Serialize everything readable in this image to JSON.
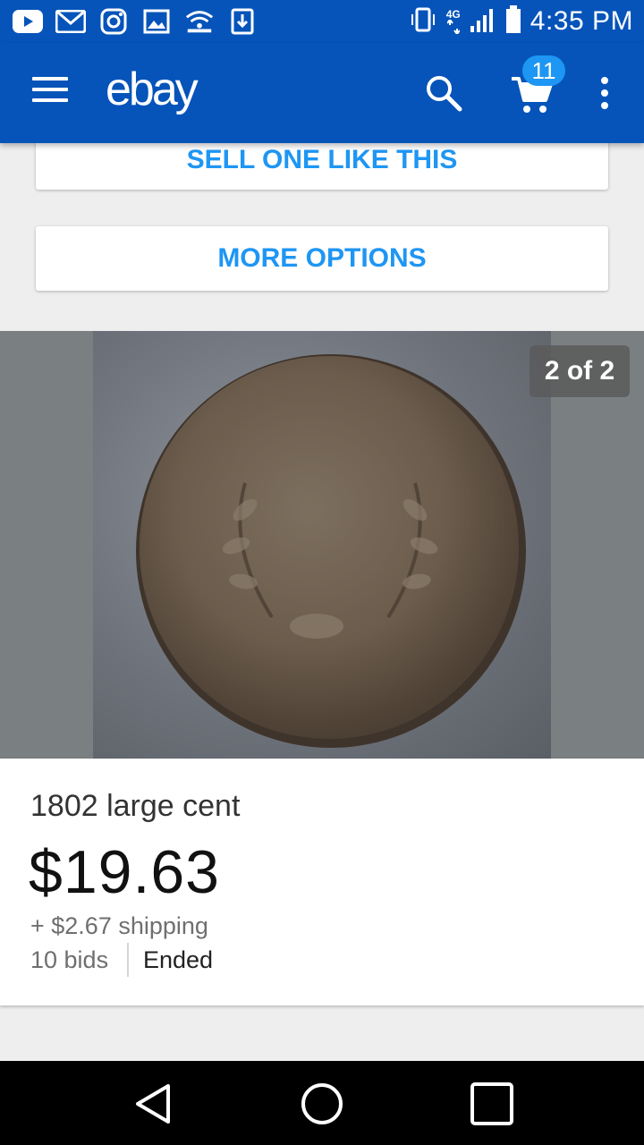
{
  "status_bar": {
    "time": "4:35 PM",
    "left_icons": [
      "youtube-icon",
      "gmail-icon",
      "instagram-icon",
      "gallery-icon",
      "wifi-hotspot-icon",
      "download-icon"
    ],
    "right_icons": [
      "vibrate-icon",
      "4g-lte-icon",
      "signal-icon",
      "battery-icon"
    ],
    "network_label": "4G"
  },
  "toolbar": {
    "logo": "ebay",
    "cart_count": "11"
  },
  "actions": {
    "sell_label": "SELL ONE LIKE THIS",
    "more_label": "MORE OPTIONS"
  },
  "gallery": {
    "page_indicator": "2 of 2"
  },
  "item": {
    "title": "1802 large cent",
    "price": "$19.63",
    "shipping": "+ $2.67 shipping",
    "bids": "10 bids",
    "status": "Ended"
  },
  "colors": {
    "brand_blue": "#0654ba",
    "accent_blue": "#1e96f3"
  }
}
